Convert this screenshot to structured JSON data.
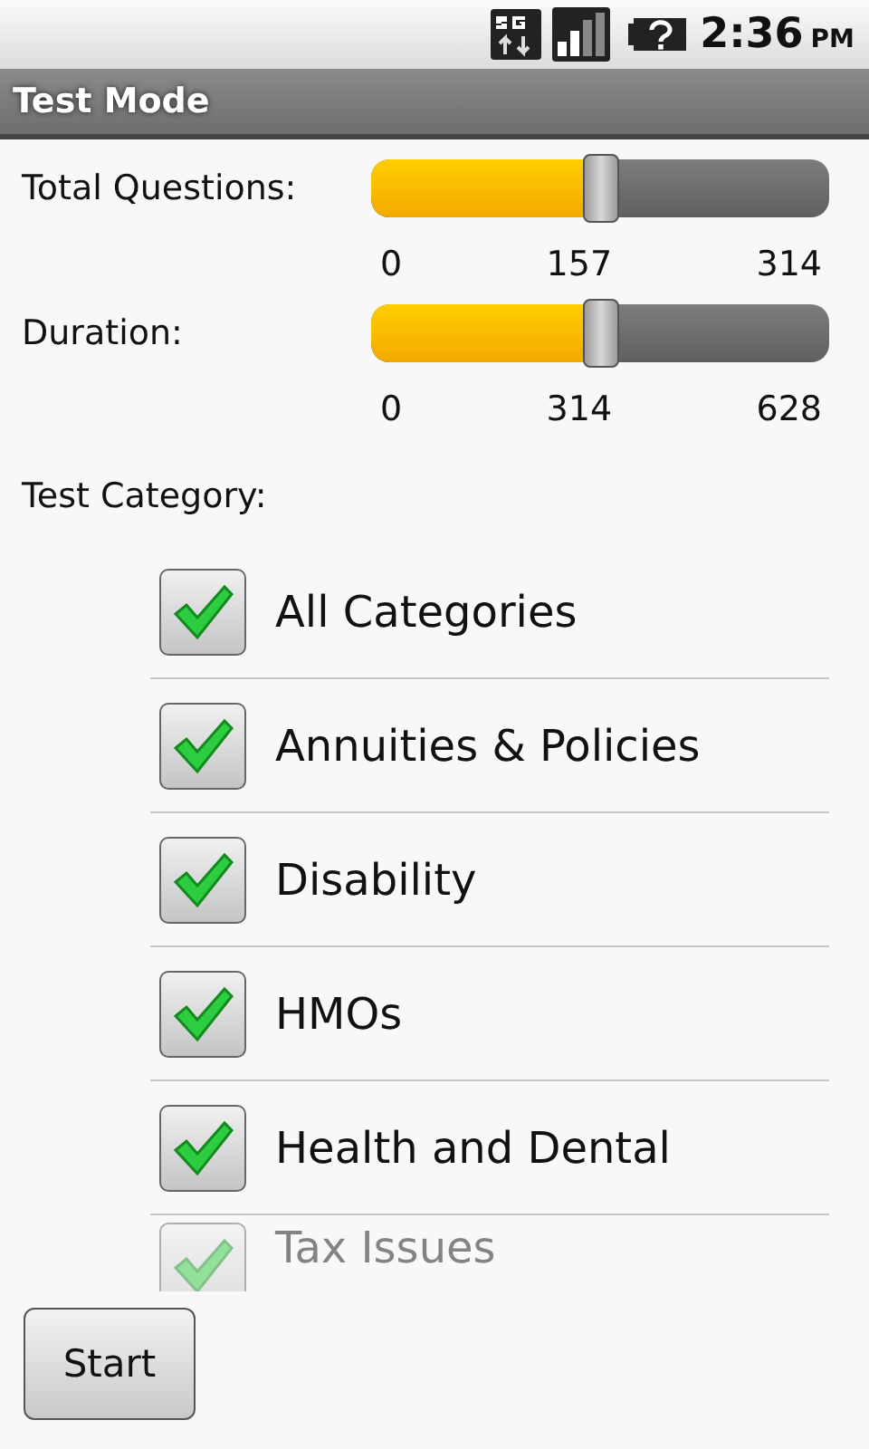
{
  "status_bar": {
    "time": "2:36",
    "ampm": "PM"
  },
  "title": "Test Mode",
  "sliders": [
    {
      "label": "Total Questions:",
      "level": 0.5,
      "ticks": [
        "0",
        "157",
        "314"
      ]
    },
    {
      "label": "Duration:",
      "level": 0.5,
      "ticks": [
        "0",
        "314",
        "628"
      ]
    }
  ],
  "category_label": "Test Category:",
  "categories": [
    {
      "label": "All Categories",
      "checked": true
    },
    {
      "label": "Annuities & Policies",
      "checked": true
    },
    {
      "label": "Disability",
      "checked": true
    },
    {
      "label": "HMOs",
      "checked": true
    },
    {
      "label": "Health and Dental",
      "checked": true
    },
    {
      "label": "Tax Issues",
      "checked": true
    }
  ],
  "start_button": "Start"
}
